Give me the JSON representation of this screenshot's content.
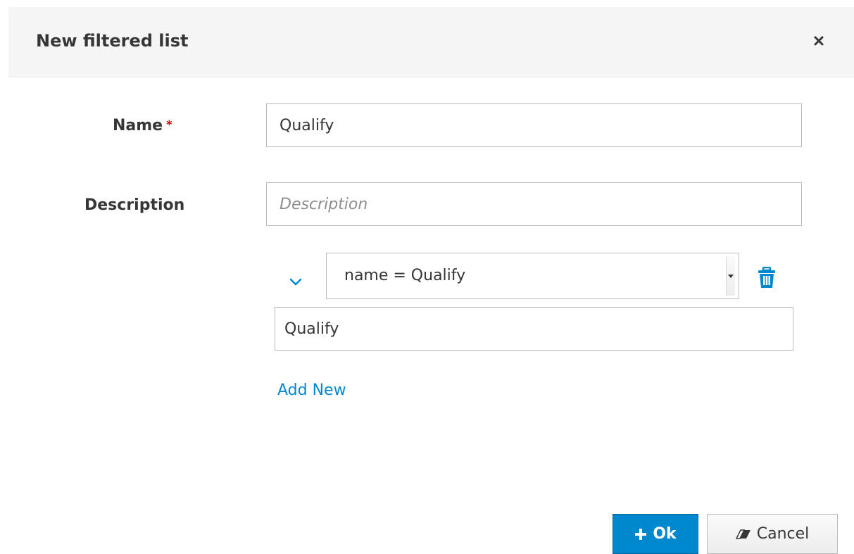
{
  "dialog": {
    "title": "New filtered list",
    "close_label": "×"
  },
  "form": {
    "name_label": "Name",
    "required_marker": "*",
    "name_value": "Qualify",
    "description_label": "Description",
    "description_placeholder": "Description",
    "description_value": ""
  },
  "filter": {
    "selected": "name = Qualify",
    "value": "Qualify",
    "add_new_label": "Add New"
  },
  "footer": {
    "ok_label": "Ok",
    "cancel_label": "Cancel"
  },
  "colors": {
    "accent": "#0088ce",
    "required": "#cc0000",
    "header_bg": "#f5f5f5"
  },
  "icons": {
    "close": "close-icon",
    "chevron": "chevron-down-icon",
    "trash": "trash-icon",
    "plus": "plus-icon",
    "eraser": "eraser-icon"
  }
}
